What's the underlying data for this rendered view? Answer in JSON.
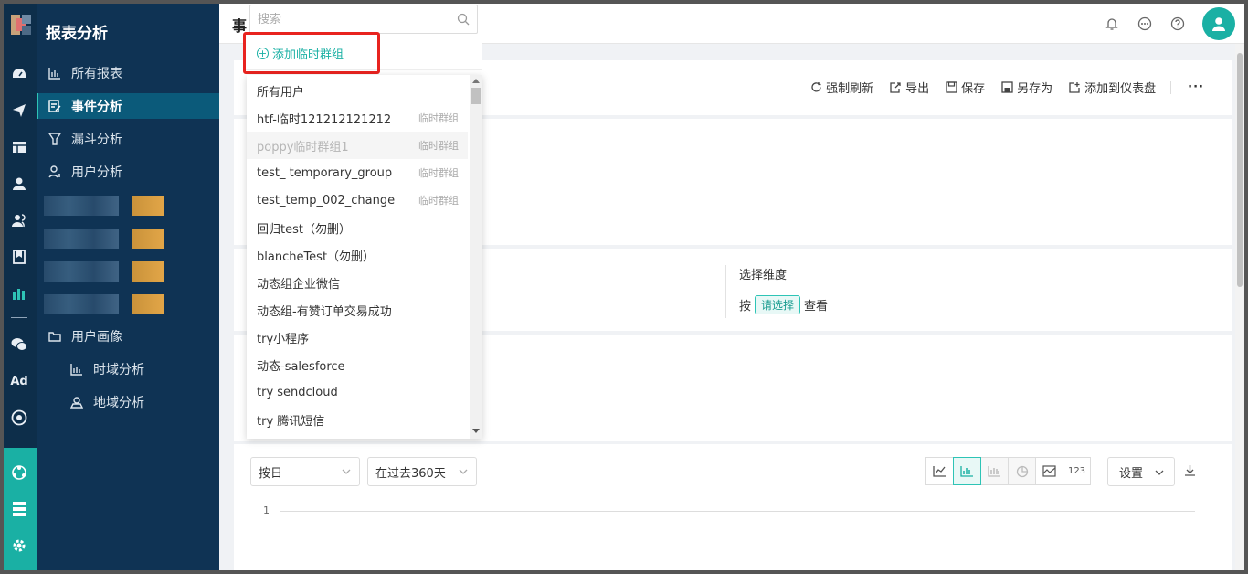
{
  "nav": {
    "title": "报表分析",
    "items": [
      {
        "label": "所有报表"
      },
      {
        "label": "事件分析"
      },
      {
        "label": "漏斗分析"
      },
      {
        "label": "用户分析"
      },
      {
        "label": "用户画像"
      },
      {
        "label": "时域分析"
      },
      {
        "label": "地域分析"
      }
    ],
    "rail_icons": [
      "dashboard-icon",
      "send-icon",
      "layout-icon",
      "user-icon",
      "users-icon",
      "bookmark-icon",
      "bar-chart-icon",
      "wechat-icon",
      "ad-icon",
      "target-icon",
      "org-icon",
      "server-icon",
      "gear-icon"
    ],
    "ad_label": "Ad"
  },
  "header": {
    "title": "事"
  },
  "dropdown": {
    "search_placeholder": "搜索",
    "add_label": "添加临时群组",
    "items": [
      {
        "label": "所有用户",
        "tag": ""
      },
      {
        "label": "htf-临时121212121212",
        "tag": "临时群组"
      },
      {
        "label": "poppy临时群组1",
        "tag": "临时群组"
      },
      {
        "label": "test_ temporary_group",
        "tag": "临时群组"
      },
      {
        "label": "test_temp_002_change",
        "tag": "临时群组"
      },
      {
        "label": "回归test（勿删）",
        "tag": ""
      },
      {
        "label": "blancheTest（勿删）",
        "tag": ""
      },
      {
        "label": "动态组企业微信",
        "tag": ""
      },
      {
        "label": "动态组-有赞订单交易成功",
        "tag": ""
      },
      {
        "label": "try小程序",
        "tag": ""
      },
      {
        "label": "动态-salesforce",
        "tag": ""
      },
      {
        "label": "try sendcloud",
        "tag": ""
      },
      {
        "label": "try 腾讯短信",
        "tag": ""
      }
    ]
  },
  "toolbar": {
    "refresh": "强制刷新",
    "export": "导出",
    "save": "保存",
    "save_as": "另存为",
    "add_dashboard": "添加到仪表盘",
    "more": "···"
  },
  "dimension": {
    "label": "选择维度",
    "prefix": "按",
    "pick": "请选择",
    "suffix": "查看"
  },
  "chart_controls": {
    "granularity": "按日",
    "range": "在过去360天",
    "number_label": "123",
    "settings": "设置",
    "axis_tick": "1"
  },
  "colors": {
    "accent": "#1ab0a4",
    "sidebar": "#0f3354",
    "highlight_box": "#e8231f"
  }
}
